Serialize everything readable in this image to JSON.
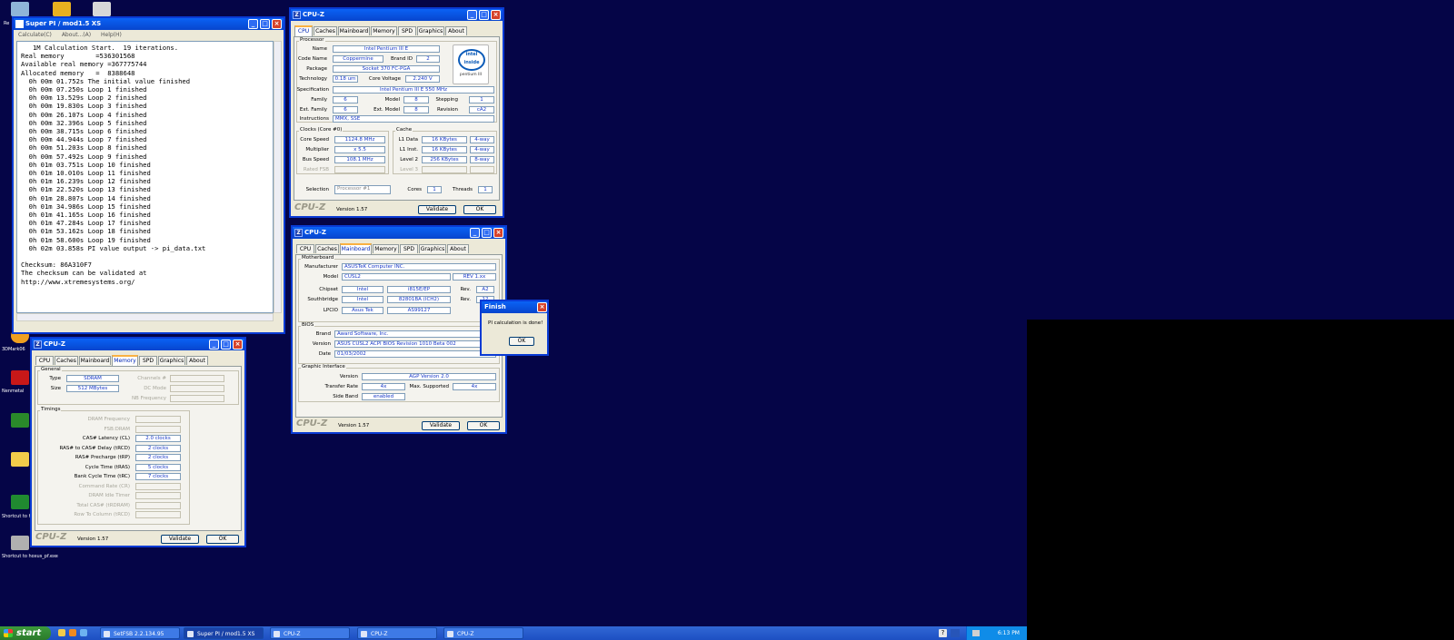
{
  "taskbar": {
    "start_label": "start",
    "buttons": [
      "SetFSB 2.2.134.95",
      "Super PI / mod1.5 XS",
      "CPU-Z",
      "CPU-Z",
      "CPU-Z"
    ],
    "clock": "6:13 PM",
    "help_glyph": "?"
  },
  "desktop": {
    "icons": [
      "Re",
      "3DMark06",
      "Nenmetal",
      "Shortcut to Hdmal",
      "Shortcut to hoxus_pf.exe"
    ]
  },
  "superpi": {
    "title": "Super PI / mod1.5 XS",
    "menu": [
      "Calculate(C)",
      "About...(A)",
      "Help(H)"
    ],
    "console": "   1M Calculation Start.  19 iterations.\nReal memory        =536301568\nAvailable real memory =367775744\nAllocated memory   =  8388648\n  0h 00m 01.752s The initial value finished\n  0h 00m 07.250s Loop 1 finished\n  0h 00m 13.529s Loop 2 finished\n  0h 00m 19.830s Loop 3 finished\n  0h 00m 26.107s Loop 4 finished\n  0h 00m 32.396s Loop 5 finished\n  0h 00m 38.715s Loop 6 finished\n  0h 00m 44.944s Loop 7 finished\n  0h 00m 51.203s Loop 8 finished\n  0h 00m 57.492s Loop 9 finished\n  0h 01m 03.751s Loop 10 finished\n  0h 01m 10.010s Loop 11 finished\n  0h 01m 16.239s Loop 12 finished\n  0h 01m 22.520s Loop 13 finished\n  0h 01m 28.807s Loop 14 finished\n  0h 01m 34.986s Loop 15 finished\n  0h 01m 41.165s Loop 16 finished\n  0h 01m 47.284s Loop 17 finished\n  0h 01m 53.162s Loop 18 finished\n  0h 01m 58.600s Loop 19 finished\n  0h 02m 03.858s PI value output -> pi_data.txt\n\nChecksum: 86A310F7\nThe checksum can be validated at\nhttp://www.xtremesystems.org/"
  },
  "cpuz_tabs": [
    "CPU",
    "Caches",
    "Mainboard",
    "Memory",
    "SPD",
    "Graphics",
    "About"
  ],
  "cpuz_brand": "CPU-Z",
  "cpuz_version": "Version 1.57",
  "validate_label": "Validate",
  "ok_label": "OK",
  "win_title": "CPU-Z",
  "cpu": {
    "processor_group": "Processor",
    "name_label": "Name",
    "name": "Intel Pentium III E",
    "codename_label": "Code Name",
    "codename": "Coppermine",
    "brandid_label": "Brand ID",
    "brandid": "2",
    "package_label": "Package",
    "package": "Socket 370 FC-PGA",
    "tech_label": "Technology",
    "tech": "0.18 um",
    "voltage_label": "Core Voltage",
    "voltage": "2.240 V",
    "spec_label": "Specification",
    "spec": "Intel Pentium III E 550 MHz",
    "family_label": "Family",
    "family": "6",
    "model_label": "Model",
    "model": "8",
    "stepping_label": "Stepping",
    "stepping": "1",
    "extfamily_label": "Ext. Family",
    "extfamily": "6",
    "extmodel_label": "Ext. Model",
    "extmodel": "8",
    "revision_label": "Revision",
    "revision": "cA2",
    "instr_label": "Instructions",
    "instr": "MMX, SSE",
    "logo_text": "intel inside",
    "logo_sub": "pentium III",
    "clocks_group": "Clocks (Core #0)",
    "corespeed_label": "Core Speed",
    "corespeed": "1124.8 MHz",
    "mult_label": "Multiplier",
    "mult": "x 5.5",
    "bus_label": "Bus Speed",
    "bus": "108.1 MHz",
    "ratedfsb_label": "Rated FSB",
    "cache_group": "Cache",
    "l1d_label": "L1 Data",
    "l1d": "16 KBytes",
    "l1d_way": "4-way",
    "l1i_label": "L1 Inst.",
    "l1i": "16 KBytes",
    "l1i_way": "4-way",
    "l2_label": "Level 2",
    "l2": "256 KBytes",
    "l2_way": "8-way",
    "l3_label": "Level 3",
    "selection_label": "Selection",
    "selection": "Processor #1",
    "cores_label": "Cores",
    "cores": "1",
    "threads_label": "Threads",
    "threads": "1"
  },
  "mainboard": {
    "mb_group": "Motherboard",
    "manu_label": "Manufacturer",
    "manu": "ASUSTeK Computer INC.",
    "model_label": "Model",
    "model": "CUSL2",
    "model_rev": "REV 1.xx",
    "chipset_label": "Chipset",
    "chipset": "Intel",
    "chipset2": "i815E/EP",
    "rev_label": "Rev.",
    "chipset_rev": "A2",
    "south_label": "Southbridge",
    "south": "Intel",
    "south2": "82801BA (ICH2)",
    "rev2_label": "Rev.",
    "south_rev": "12",
    "lpcio_label": "LPCIO",
    "lpcio": "Asus Tek",
    "lpcio2": "AS99127",
    "bios_group": "BIOS",
    "brand_label": "Brand",
    "brand": "Award Software, Inc.",
    "version_label": "Version",
    "version": "ASUS CUSL2 ACPI BIOS Revision 1010 Beta 002",
    "date_label": "Date",
    "date": "01/03/2002",
    "gfx_group": "Graphic Interface",
    "gver_label": "Version",
    "gver": "AGP Version 2.0",
    "rate_label": "Transfer Rate",
    "rate": "4x",
    "maxsup_label": "Max. Supported",
    "maxsup": "4x",
    "sideband_label": "Side Band",
    "sideband": "enabled"
  },
  "memory": {
    "general_group": "General",
    "type_label": "Type",
    "type": "SDRAM",
    "size_label": "Size",
    "size": "512 MBytes",
    "channels_label": "Channels #",
    "dcmode_label": "DC Mode",
    "nbfreq_label": "NB Frequency",
    "timings_group": "Timings",
    "t_labels": [
      "DRAM Frequency",
      "FSB:DRAM",
      "CAS# Latency (CL)",
      "RAS# to CAS# Delay (tRCD)",
      "RAS# Precharge (tRP)",
      "Cycle Time (tRAS)",
      "Bank Cycle Time (tRC)",
      "Command Rate (CR)",
      "DRAM Idle Timer",
      "Total CAS# (tRDRAM)",
      "Row To Column (tRCD)"
    ],
    "t_values": [
      "",
      "",
      "2.0 clocks",
      "2 clocks",
      "2 clocks",
      "5 clocks",
      "7 clocks",
      "",
      "",
      "",
      ""
    ]
  },
  "finish": {
    "title": "Finish",
    "message": "PI calculation is done!",
    "ok": "OK"
  }
}
